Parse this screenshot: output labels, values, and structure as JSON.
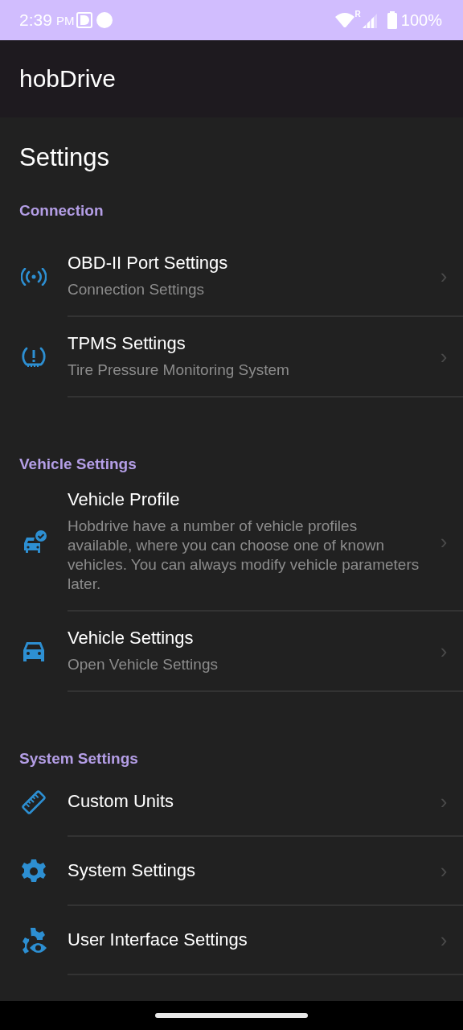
{
  "status_bar": {
    "time": "2:39",
    "ampm": "PM",
    "battery": "100%",
    "roaming": "R"
  },
  "app_bar": {
    "title": "hobDrive"
  },
  "page_title": "Settings",
  "sections": [
    {
      "header": "Connection",
      "items": [
        {
          "title": "OBD-II Port Settings",
          "subtitle": "Connection Settings",
          "chevron": "›"
        },
        {
          "title": "TPMS Settings",
          "subtitle": "Tire Pressure Monitoring System",
          "chevron": "›"
        }
      ]
    },
    {
      "header": "Vehicle Settings",
      "items": [
        {
          "title": "Vehicle Profile",
          "subtitle": "Hobdrive have a number of vehicle profiles available, where you can choose one of known vehicles. You can always modify vehicle parameters later.",
          "chevron": "›"
        },
        {
          "title": "Vehicle Settings",
          "subtitle": "Open Vehicle Settings",
          "chevron": "›"
        }
      ]
    },
    {
      "header": "System Settings",
      "items": [
        {
          "title": "Custom Units",
          "chevron": "›"
        },
        {
          "title": "System Settings",
          "chevron": "›"
        },
        {
          "title": "User Interface Settings",
          "chevron": "›"
        }
      ]
    }
  ]
}
